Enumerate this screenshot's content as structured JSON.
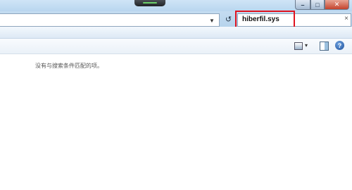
{
  "window": {
    "caption_buttons": [
      "minimize",
      "maximize",
      "close"
    ]
  },
  "address_bar": {
    "arrow_icon": "chevron-down-icon",
    "refresh_icon": "refresh-icon"
  },
  "search": {
    "query": "hiberfil.sys",
    "clear_label": "×",
    "highlight_color": "#e0121e"
  },
  "toolbar": {
    "dropdown_arrow": "▾",
    "help_label": "?"
  },
  "content": {
    "empty_message": "没有与搜索条件匹配的项。"
  },
  "colors": {
    "glass": "#c4dcf1",
    "close_button": "#c4432d"
  }
}
